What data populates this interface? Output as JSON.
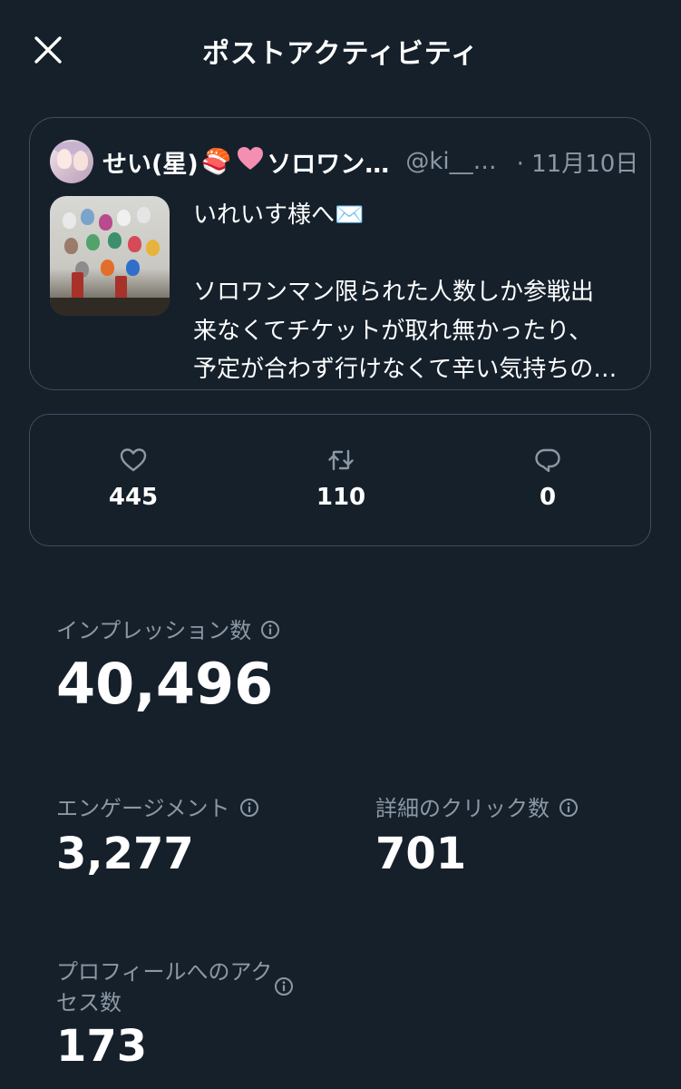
{
  "header": {
    "title": "ポストアクティビティ"
  },
  "tweet": {
    "author_name": "せい(星)",
    "author_name_suffix": "ソロワン…",
    "emoji_1": "🍣",
    "emoji_2": "🩷",
    "handle": "@ki__…",
    "date": "· 11月10日",
    "text": "いれいす様へ✉️\n\nソロワンマン限られた人数しか参戦出\n来なくてチケットが取れ無かったり、\n予定が合わず行けなくて辛い気持ちの…"
  },
  "engagement_stats": {
    "likes": "445",
    "reposts": "110",
    "replies": "0"
  },
  "metrics": {
    "impressions_label": "インプレッション数",
    "impressions_value": "40,496",
    "engagement_label": "エンゲージメント",
    "engagement_value": "3,277",
    "detail_clicks_label": "詳細のクリック数",
    "detail_clicks_value": "701",
    "profile_access_label": "プロフィールへのアク\nセス数",
    "profile_access_value": "173"
  },
  "colors": {
    "background": "#15202b",
    "border": "#3d4f61",
    "secondary_text": "#8b98a5",
    "primary_text": "#ffffff"
  },
  "icons": {
    "close": "close-icon",
    "like": "heart-icon",
    "repost": "repost-icon",
    "reply": "reply-bubble-icon",
    "info": "info-icon"
  }
}
